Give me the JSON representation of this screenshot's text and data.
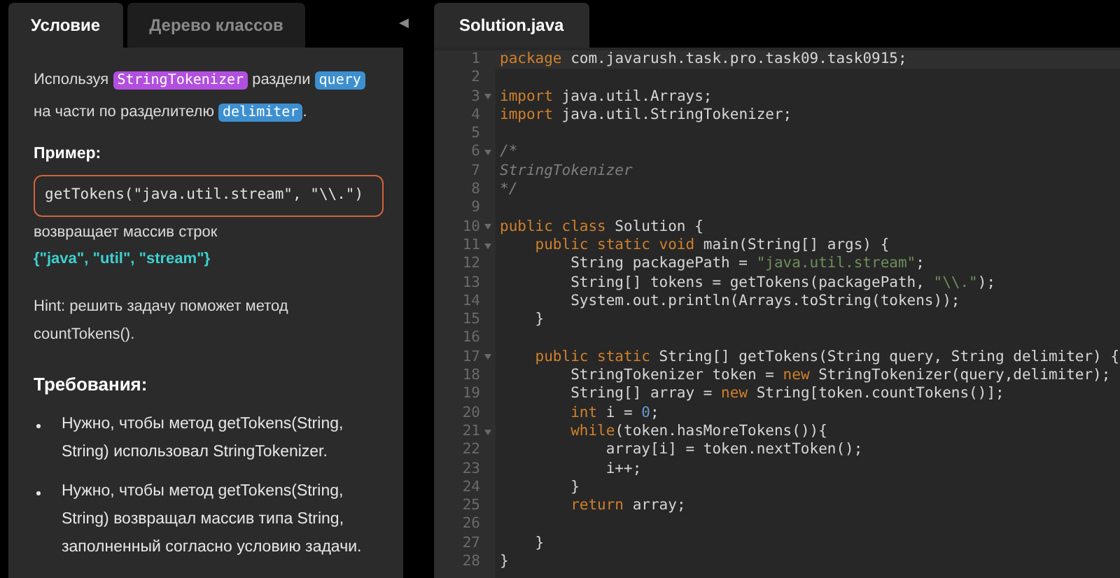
{
  "left_tabs": [
    {
      "label": "Условие",
      "selected": true
    },
    {
      "label": "Дерево классов",
      "selected": false
    }
  ],
  "collapse_glyph": "◀",
  "description": [
    {
      "kind": "text",
      "text": "Используя "
    },
    {
      "kind": "tag",
      "text": "StringTokenizer",
      "color": "#b24fe0"
    },
    {
      "kind": "text",
      "text": " раздели "
    },
    {
      "kind": "tag",
      "text": "query",
      "color": "#3d8fd0"
    },
    {
      "kind": "text",
      "text": " на части по разделителю "
    },
    {
      "kind": "tag",
      "text": "delimiter",
      "color": "#3d8fd0"
    },
    {
      "kind": "text",
      "text": "."
    }
  ],
  "example_heading": "Пример:",
  "example_code": "getTokens(\"java.util.stream\", \"\\\\.\")",
  "example_returns": "возвращает массив строк",
  "example_result": "{\"java\", \"util\", \"stream\"}",
  "hint": "Hint: решить задачу поможет метод countTokens().",
  "requirements_heading": "Требования:",
  "requirements": [
    "Нужно, чтобы метод getTokens(String, String) использовал StringTokenizer.",
    "Нужно, чтобы метод getTokens(String, String) возвращал массив типа String, заполненный согласно условию задачи."
  ],
  "editor_tabs": [
    {
      "label": "Solution.java",
      "selected": true
    }
  ],
  "code_lines": [
    {
      "number": "1",
      "fold": false,
      "tokens": [
        {
          "kind": "keyword",
          "text": "package"
        },
        {
          "kind": "plain",
          "text": " com.javarush.task.pro.task09.task0915;"
        }
      ]
    },
    {
      "number": "2",
      "fold": false
    },
    {
      "number": "3",
      "fold": true,
      "tokens": [
        {
          "kind": "keyword",
          "text": "import"
        },
        {
          "kind": "plain",
          "text": " java.util.Arrays;"
        }
      ]
    },
    {
      "number": "4",
      "fold": false,
      "tokens": [
        {
          "kind": "keyword",
          "text": "import"
        },
        {
          "kind": "plain",
          "text": " java.util.StringTokenizer;"
        }
      ]
    },
    {
      "number": "5",
      "fold": false
    },
    {
      "number": "6",
      "fold": true,
      "tokens": [
        {
          "kind": "comment",
          "text": "/*"
        }
      ]
    },
    {
      "number": "7",
      "fold": false,
      "tokens": [
        {
          "kind": "comment",
          "text": "StringTokenizer"
        }
      ]
    },
    {
      "number": "8",
      "fold": false,
      "tokens": [
        {
          "kind": "comment",
          "text": "*/"
        }
      ]
    },
    {
      "number": "9",
      "fold": false
    },
    {
      "number": "10",
      "fold": true,
      "tokens": [
        {
          "kind": "keyword",
          "text": "public class"
        },
        {
          "kind": "plain",
          "text": " Solution {"
        }
      ]
    },
    {
      "number": "11",
      "fold": true,
      "tokens": [
        {
          "kind": "keyword",
          "text": "    public static void"
        },
        {
          "kind": "plain",
          "text": " main(String[] args) {"
        }
      ]
    },
    {
      "number": "12",
      "fold": false,
      "tokens": [
        {
          "kind": "plain",
          "text": "        String packagePath = "
        },
        {
          "kind": "string",
          "text": "\"java.util.stream\""
        },
        {
          "kind": "plain",
          "text": ";"
        }
      ]
    },
    {
      "number": "13",
      "fold": false,
      "tokens": [
        {
          "kind": "plain",
          "text": "        String[] tokens = getTokens(packagePath, "
        },
        {
          "kind": "string",
          "text": "\"\\\\.\""
        },
        {
          "kind": "plain",
          "text": ");"
        }
      ]
    },
    {
      "number": "14",
      "fold": false,
      "tokens": [
        {
          "kind": "plain",
          "text": "        System.out.println(Arrays.toString(tokens));"
        }
      ]
    },
    {
      "number": "15",
      "fold": false,
      "tokens": [
        {
          "kind": "plain",
          "text": "    }"
        }
      ]
    },
    {
      "number": "16",
      "fold": false
    },
    {
      "number": "17",
      "fold": true,
      "tokens": [
        {
          "kind": "keyword",
          "text": "    public static"
        },
        {
          "kind": "plain",
          "text": " String[] getTokens(String query, String delimiter) {"
        }
      ]
    },
    {
      "number": "18",
      "fold": false,
      "tokens": [
        {
          "kind": "plain",
          "text": "        StringTokenizer token = "
        },
        {
          "kind": "keyword",
          "text": "new"
        },
        {
          "kind": "plain",
          "text": " StringTokenizer(query,delimiter);"
        }
      ]
    },
    {
      "number": "19",
      "fold": false,
      "tokens": [
        {
          "kind": "plain",
          "text": "        String[] array = "
        },
        {
          "kind": "keyword",
          "text": "new"
        },
        {
          "kind": "plain",
          "text": " String[token.countTokens()];"
        }
      ]
    },
    {
      "number": "20",
      "fold": false,
      "tokens": [
        {
          "kind": "keyword",
          "text": "        int"
        },
        {
          "kind": "plain",
          "text": " i = "
        },
        {
          "kind": "number",
          "text": "0"
        },
        {
          "kind": "plain",
          "text": ";"
        }
      ]
    },
    {
      "number": "21",
      "fold": true,
      "tokens": [
        {
          "kind": "keyword",
          "text": "        while"
        },
        {
          "kind": "plain",
          "text": "(token.hasMoreTokens()){"
        }
      ]
    },
    {
      "number": "22",
      "fold": false,
      "tokens": [
        {
          "kind": "plain",
          "text": "            array[i] = token.nextToken();"
        }
      ]
    },
    {
      "number": "23",
      "fold": false,
      "tokens": [
        {
          "kind": "plain",
          "text": "            i++;"
        }
      ]
    },
    {
      "number": "24",
      "fold": false,
      "tokens": [
        {
          "kind": "plain",
          "text": "        }"
        }
      ]
    },
    {
      "number": "25",
      "fold": false,
      "tokens": [
        {
          "kind": "keyword",
          "text": "        return"
        },
        {
          "kind": "plain",
          "text": " array;"
        }
      ]
    },
    {
      "number": "26",
      "fold": false
    },
    {
      "number": "27",
      "fold": false,
      "tokens": [
        {
          "kind": "plain",
          "text": "    }"
        }
      ]
    },
    {
      "number": "28",
      "fold": false,
      "tokens": [
        {
          "kind": "plain",
          "text": "}"
        }
      ]
    }
  ]
}
